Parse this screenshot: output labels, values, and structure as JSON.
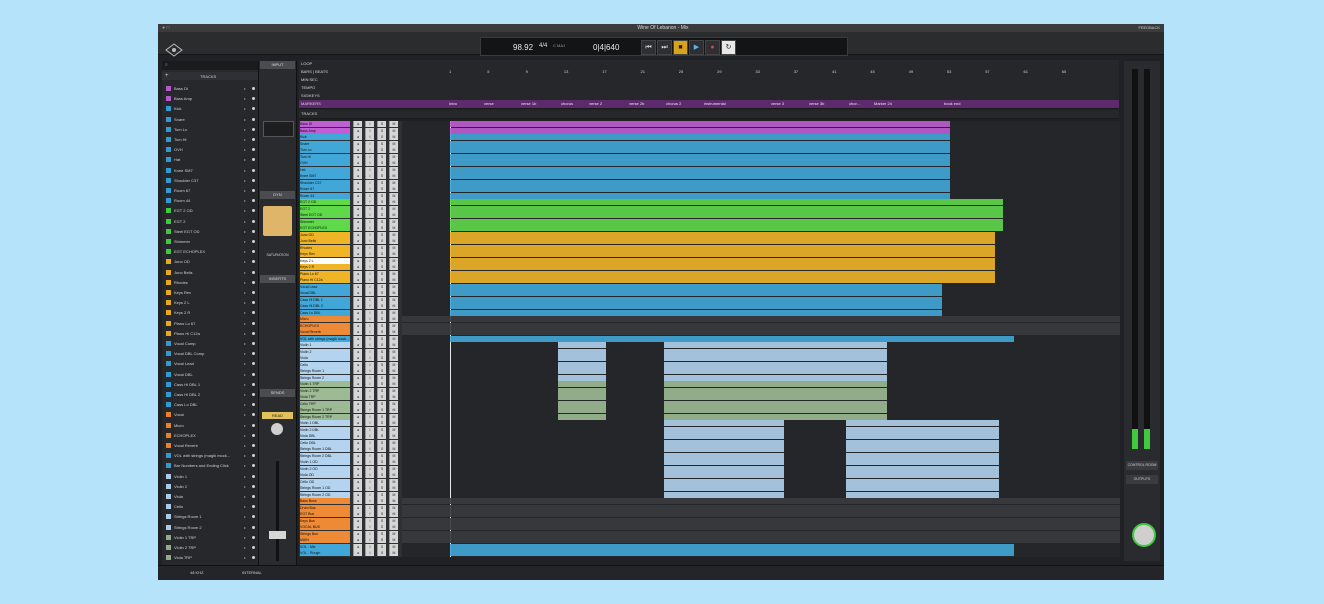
{
  "window": {
    "title": "Wine Of Lebanon - Mix",
    "feedback": "FEEDBACK"
  },
  "transport": {
    "tempo": "98.92",
    "time_sig": "4/4",
    "key": "C MAJ",
    "position": "0|4|640",
    "buttons": [
      "rewind",
      "forward",
      "stop",
      "play",
      "record",
      "loop"
    ]
  },
  "sidebar": {
    "search_placeholder": "",
    "header": "TRACKS",
    "items": [
      {
        "label": "Bass DI",
        "color": "#b45ac8"
      },
      {
        "label": "Bass Amp",
        "color": "#b45ac8"
      },
      {
        "label": "Kick",
        "color": "#2f9bd0"
      },
      {
        "label": "Snare",
        "color": "#2f9bd0"
      },
      {
        "label": "Tom Lo",
        "color": "#2f9bd0"
      },
      {
        "label": "Tom Hi",
        "color": "#2f9bd0"
      },
      {
        "label": "OVH",
        "color": "#2f9bd0"
      },
      {
        "label": "Hat",
        "color": "#2f9bd0"
      },
      {
        "label": "Knee SM7",
        "color": "#2f9bd0"
      },
      {
        "label": "Shoulder C37",
        "color": "#2f9bd0"
      },
      {
        "label": "Room 67",
        "color": "#2f9bd0"
      },
      {
        "label": "Room 44",
        "color": "#2f9bd0"
      },
      {
        "label": "EGT 2 OD",
        "color": "#3ec93e"
      },
      {
        "label": "EGT 2",
        "color": "#3ec93e"
      },
      {
        "label": "Steel EGT OD",
        "color": "#3ec93e"
      },
      {
        "label": "Shimmer",
        "color": "#3ec93e"
      },
      {
        "label": "EGT ECHOPLEX",
        "color": "#3ec93e"
      },
      {
        "label": "Juno OD",
        "color": "#e8a91c"
      },
      {
        "label": "Juno Bells",
        "color": "#e8a91c"
      },
      {
        "label": "Rhodes",
        "color": "#e8a91c"
      },
      {
        "label": "Keys Rev",
        "color": "#e8a91c"
      },
      {
        "label": "Keys 2 L",
        "color": "#e8a91c"
      },
      {
        "label": "Keys 2 R",
        "color": "#e8a91c"
      },
      {
        "label": "Piano Lo 67",
        "color": "#e8a91c"
      },
      {
        "label": "Piano Hi C12a",
        "color": "#e8a91c"
      },
      {
        "label": "Vocal Comp",
        "color": "#2f9bd0"
      },
      {
        "label": "Vocal DBL Comp",
        "color": "#2f9bd0"
      },
      {
        "label": "Vocal Lead",
        "color": "#2f9bd0"
      },
      {
        "label": "Vocal DBL",
        "color": "#2f9bd0"
      },
      {
        "label": "Cass Hi DBL 1",
        "color": "#2f9bd0"
      },
      {
        "label": "Cass Hi DBL 2",
        "color": "#2f9bd0"
      },
      {
        "label": "Cass Lo DBL",
        "color": "#2f9bd0"
      },
      {
        "label": "Vocal",
        "color": "#e8812c"
      },
      {
        "label": "Micro",
        "color": "#e8812c"
      },
      {
        "label": "ECHOPLEX",
        "color": "#e8812c"
      },
      {
        "label": "Vocal Reverb",
        "color": "#e8812c"
      },
      {
        "label": "VOL with strings (magik mock...",
        "color": "#2f9bd0"
      },
      {
        "label": "Bar Numbers and Ending Click",
        "color": "#2f9bd0"
      },
      {
        "label": "Violin 1",
        "color": "#a9cbe8"
      },
      {
        "label": "Violin 2",
        "color": "#a9cbe8"
      },
      {
        "label": "Viola",
        "color": "#a9cbe8"
      },
      {
        "label": "Cello",
        "color": "#a9cbe8"
      },
      {
        "label": "Strings Room 1",
        "color": "#a9cbe8"
      },
      {
        "label": "Strings Room 2",
        "color": "#a9cbe8"
      },
      {
        "label": "Violin 1 TRP",
        "color": "#8fae88"
      },
      {
        "label": "Violin 2 TRP",
        "color": "#8fae88"
      },
      {
        "label": "Viola TRP",
        "color": "#8fae88"
      }
    ]
  },
  "channel": {
    "input": "INPUT",
    "dyn": "DYN",
    "inserts": "INSERTS",
    "sends": "SENDS",
    "read": "READ",
    "saturation": "SATURATION",
    "track_name": "Keys 2 L"
  },
  "rulers": {
    "loop": "LOOP",
    "bars_beats": "BARS | BEATS",
    "min_sec": "MIN:SEC",
    "tempo": "TEMPO",
    "sig": "SIG/KEYS",
    "markers": "MARKERS",
    "tracks": "TRACKS",
    "bar_numbers": [
      "1",
      "5",
      "9",
      "13",
      "17",
      "21",
      "25",
      "29",
      "33",
      "37",
      "41",
      "45",
      "49",
      "53",
      "57",
      "61",
      "65"
    ],
    "marker_labels": [
      "Intro",
      "verse",
      "verse 1b",
      "chorus",
      "verse 2",
      "verse 2b",
      "chorus 2",
      "instrumental",
      "verse 3",
      "verse 3b",
      "chor...",
      "Marker 24",
      "book end"
    ]
  },
  "track_rows": [
    {
      "name": "Bass DI",
      "color": "#c05ed3"
    },
    {
      "name": "Bass Amp",
      "color": "#c05ed3"
    },
    {
      "name": "Kick",
      "color": "#41a7d8"
    },
    {
      "name": "Snare",
      "color": "#41a7d8"
    },
    {
      "name": "Tom Lo",
      "color": "#41a7d8"
    },
    {
      "name": "Tom Hi",
      "color": "#41a7d8"
    },
    {
      "name": "OVH",
      "color": "#41a7d8"
    },
    {
      "name": "Hat",
      "color": "#41a7d8"
    },
    {
      "name": "Knee SM7",
      "color": "#41a7d8"
    },
    {
      "name": "Shoulder C37",
      "color": "#41a7d8"
    },
    {
      "name": "Room 67",
      "color": "#41a7d8"
    },
    {
      "name": "Room 44",
      "color": "#41a7d8"
    },
    {
      "name": "EGT 2 OD",
      "color": "#5fd84a"
    },
    {
      "name": "EGT 2",
      "color": "#5fd84a"
    },
    {
      "name": "Steel EGT OD",
      "color": "#5fd84a"
    },
    {
      "name": "Shimmer",
      "color": "#5fd84a"
    },
    {
      "name": "EGT ECHOPLEX",
      "color": "#5fd84a"
    },
    {
      "name": "Juno OD",
      "color": "#f0b427"
    },
    {
      "name": "Juno Bells",
      "color": "#f0b427"
    },
    {
      "name": "Rhodes",
      "color": "#f0b427"
    },
    {
      "name": "Keys Rev",
      "color": "#f0b427"
    },
    {
      "name": "Keys 2 L",
      "color": "#ffffff"
    },
    {
      "name": "Keys 2 R",
      "color": "#f0b427"
    },
    {
      "name": "Piano Lo 67",
      "color": "#f0b427"
    },
    {
      "name": "Piano Hi C12a",
      "color": "#f0b427"
    },
    {
      "name": "Vocal Lead",
      "color": "#41a7d8"
    },
    {
      "name": "Vocal DBL",
      "color": "#41a7d8"
    },
    {
      "name": "Cass Hi DBL 1",
      "color": "#41a7d8"
    },
    {
      "name": "Cass Hi DBL 2",
      "color": "#41a7d8"
    },
    {
      "name": "Cass Lo DBL",
      "color": "#41a7d8"
    },
    {
      "name": "Micro",
      "color": "#ee8a35"
    },
    {
      "name": "ECHOPLEX",
      "color": "#ee8a35"
    },
    {
      "name": "Vocal Reverb",
      "color": "#ee8a35"
    },
    {
      "name": "VOL with strings (magik mock...",
      "color": "#41a7d8"
    },
    {
      "name": "Violin 1",
      "color": "#b3d3ee"
    },
    {
      "name": "Violin 2",
      "color": "#b3d3ee"
    },
    {
      "name": "Viola",
      "color": "#b3d3ee"
    },
    {
      "name": "Cello",
      "color": "#b3d3ee"
    },
    {
      "name": "Strings Room 1",
      "color": "#b3d3ee"
    },
    {
      "name": "Strings Room 2",
      "color": "#b3d3ee"
    },
    {
      "name": "Violin 1 TRP",
      "color": "#9cbb94"
    },
    {
      "name": "Violin 2 TRP",
      "color": "#9cbb94"
    },
    {
      "name": "Viola TRP",
      "color": "#9cbb94"
    },
    {
      "name": "Cello TRP",
      "color": "#9cbb94"
    },
    {
      "name": "Strings Room 1 TRP",
      "color": "#9cbb94"
    },
    {
      "name": "Strings Room 2 TRP",
      "color": "#9cbb94"
    },
    {
      "name": "Violin 1 DBL",
      "color": "#b3d3ee"
    },
    {
      "name": "Violin 2 DBL",
      "color": "#b3d3ee"
    },
    {
      "name": "Viola DBL",
      "color": "#b3d3ee"
    },
    {
      "name": "Cello DBL",
      "color": "#b3d3ee"
    },
    {
      "name": "Strings Room 1 DBL",
      "color": "#b3d3ee"
    },
    {
      "name": "Strings Room 2 DBL",
      "color": "#b3d3ee"
    },
    {
      "name": "Violin 1 OD",
      "color": "#b3d3ee"
    },
    {
      "name": "Violin 2 OD",
      "color": "#b3d3ee"
    },
    {
      "name": "Viola OD",
      "color": "#b3d3ee"
    },
    {
      "name": "Cello OD",
      "color": "#b3d3ee"
    },
    {
      "name": "Strings Room 1 OD",
      "color": "#b3d3ee"
    },
    {
      "name": "Strings Room 2 OD",
      "color": "#b3d3ee"
    },
    {
      "name": "Bass Buss",
      "color": "#ee8a35"
    },
    {
      "name": "Drum Bus",
      "color": "#ee8a35"
    },
    {
      "name": "EGT Bus",
      "color": "#ee8a35"
    },
    {
      "name": "Keys Bus",
      "color": "#ee8a35"
    },
    {
      "name": "VOCAL BUS",
      "color": "#ee8a35"
    },
    {
      "name": "Strings Bus",
      "color": "#ee8a35"
    },
    {
      "name": "MAIN",
      "color": "#ee8a35"
    },
    {
      "name": "VOL - Mix",
      "color": "#41a7d8"
    },
    {
      "name": "VOL - Rough",
      "color": "#41a7d8"
    }
  ],
  "meters": {
    "control_room": "CONTROL ROOM",
    "outputs": "OUTPUTS"
  },
  "bottom": {
    "sample_rate": "48 KHZ",
    "clock": "INTERNAL"
  }
}
